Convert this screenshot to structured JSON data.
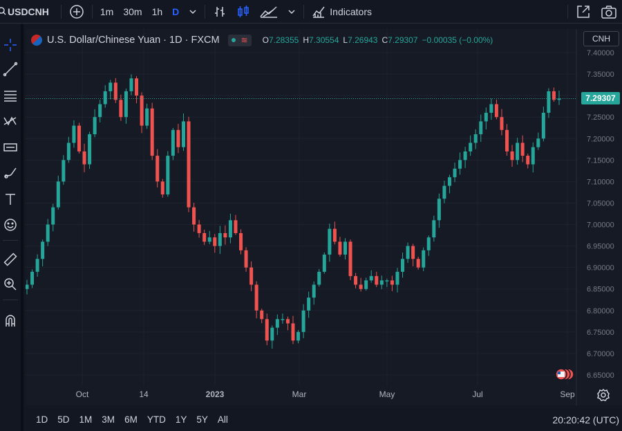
{
  "toolbar": {
    "symbol": "USDCNH",
    "intervals": [
      "1m",
      "30m",
      "1h"
    ],
    "active_interval": "D",
    "indicators_label": "Indicators"
  },
  "chart_header": {
    "title": "U.S. Dollar/Chinese Yuan · 1D · FXCM",
    "ohlc": {
      "o_label": "O",
      "o": "7.28355",
      "h_label": "H",
      "h": "7.30554",
      "l_label": "L",
      "l": "7.26943",
      "c_label": "C",
      "c": "7.29307",
      "change": "−0.00035 (−0.00%)"
    },
    "currency": "CNH"
  },
  "last_price_label": "7.29307",
  "range_buttons": [
    "1D",
    "5D",
    "1M",
    "3M",
    "6M",
    "YTD",
    "1Y",
    "5Y",
    "All"
  ],
  "time_readout": "20:20:42 (UTC)",
  "colors": {
    "background": "#161a25",
    "up": "#26a69a",
    "down": "#ef5350",
    "grid": "#1f2330",
    "accent": "#2962ff"
  },
  "icons": [
    "search-icon",
    "add-compare-icon",
    "chevron-down-icon",
    "bar-chart-icon",
    "candle-chart-icon",
    "area-chart-icon",
    "indicators-icon",
    "fullscreen-icon",
    "camera-icon",
    "crosshair-icon",
    "trend-line-icon",
    "fib-icon",
    "pattern-icon",
    "forecast-icon",
    "brush-icon",
    "text-icon",
    "emoji-icon",
    "ruler-icon",
    "zoom-icon",
    "magnet-icon",
    "gear-icon",
    "flag-icon"
  ],
  "chart_data": {
    "type": "candlestick",
    "symbol": "USDCNH",
    "interval": "1D",
    "ylim": [
      6.64,
      7.41
    ],
    "y_ticks": [
      "7.40000",
      "7.35000",
      "7.30000",
      "7.25000",
      "7.20000",
      "7.15000",
      "7.10000",
      "7.05000",
      "7.00000",
      "6.95000",
      "6.90000",
      "6.85000",
      "6.80000",
      "6.75000",
      "6.70000",
      "6.65000"
    ],
    "x_ticks": [
      "Oct",
      "14",
      "2023",
      "Mar",
      "May",
      "Jul",
      "Sep"
    ],
    "series_close": [
      6.86,
      6.89,
      6.92,
      6.96,
      7.0,
      7.04,
      7.1,
      7.15,
      7.19,
      7.23,
      7.17,
      7.14,
      7.21,
      7.25,
      7.28,
      7.31,
      7.33,
      7.29,
      7.25,
      7.31,
      7.34,
      7.3,
      7.23,
      7.27,
      7.16,
      7.1,
      7.07,
      7.16,
      7.22,
      7.18,
      7.24,
      7.04,
      7.0,
      6.98,
      6.96,
      6.97,
      6.95,
      6.98,
      6.97,
      7.01,
      6.98,
      6.94,
      6.9,
      6.86,
      6.8,
      6.78,
      6.73,
      6.76,
      6.78,
      6.78,
      6.77,
      6.73,
      6.75,
      6.8,
      6.83,
      6.86,
      6.89,
      6.93,
      6.99,
      6.96,
      6.93,
      6.96,
      6.88,
      6.86,
      6.85,
      6.87,
      6.88,
      6.86,
      6.87,
      6.87,
      6.86,
      6.89,
      6.92,
      6.95,
      6.92,
      6.9,
      6.94,
      6.97,
      7.01,
      7.06,
      7.09,
      7.11,
      7.13,
      7.15,
      7.17,
      7.19,
      7.21,
      7.24,
      7.26,
      7.28,
      7.25,
      7.22,
      7.17,
      7.15,
      7.19,
      7.16,
      7.14,
      7.18,
      7.2,
      7.26,
      7.31,
      7.29,
      7.29307
    ],
    "last": 7.29307
  }
}
